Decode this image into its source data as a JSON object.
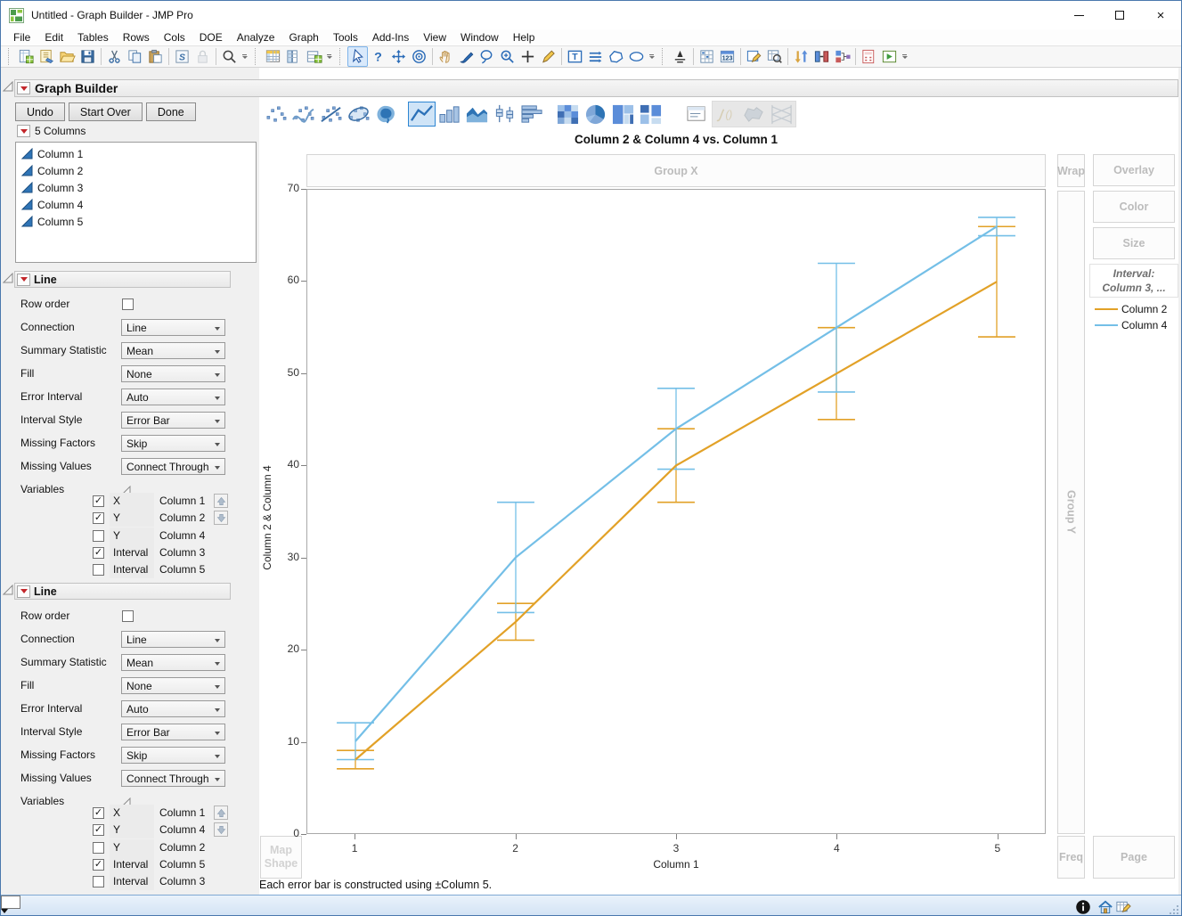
{
  "window": {
    "title": "Untitled - Graph Builder - JMP Pro"
  },
  "menu_bar": [
    "File",
    "Edit",
    "Tables",
    "Rows",
    "Cols",
    "DOE",
    "Analyze",
    "Graph",
    "Tools",
    "Add-Ins",
    "View",
    "Window",
    "Help"
  ],
  "toolbar": {
    "items": [
      {
        "t": "grip"
      },
      {
        "t": "icon",
        "n": "new-data-table"
      },
      {
        "t": "icon",
        "n": "new-journal"
      },
      {
        "t": "icon",
        "n": "open-file"
      },
      {
        "t": "icon",
        "n": "save"
      },
      {
        "t": "sep"
      },
      {
        "t": "icon",
        "n": "cut"
      },
      {
        "t": "icon",
        "n": "copy"
      },
      {
        "t": "icon",
        "n": "paste"
      },
      {
        "t": "sep"
      },
      {
        "t": "icon",
        "n": "script-center"
      },
      {
        "t": "icon",
        "n": "lock",
        "disabled": true
      },
      {
        "t": "sep"
      },
      {
        "t": "icon",
        "n": "search"
      },
      {
        "t": "chev"
      },
      {
        "t": "grip"
      },
      {
        "t": "icon",
        "n": "data-table"
      },
      {
        "t": "icon",
        "n": "new-column"
      },
      {
        "t": "icon",
        "n": "add-rows"
      },
      {
        "t": "chev"
      },
      {
        "t": "grip"
      },
      {
        "t": "icon",
        "n": "arrow-cursor",
        "selected": true
      },
      {
        "t": "icon",
        "n": "help"
      },
      {
        "t": "icon",
        "n": "move-tool"
      },
      {
        "t": "icon",
        "n": "bullseye"
      },
      {
        "t": "sep"
      },
      {
        "t": "icon",
        "n": "grabber-hand"
      },
      {
        "t": "icon",
        "n": "brush-tool"
      },
      {
        "t": "icon",
        "n": "lasso-tool"
      },
      {
        "t": "icon",
        "n": "zoom-tool"
      },
      {
        "t": "icon",
        "n": "crosshair-plus"
      },
      {
        "t": "icon",
        "n": "annotate-pencil"
      },
      {
        "t": "sep"
      },
      {
        "t": "icon",
        "n": "text-annotation"
      },
      {
        "t": "icon",
        "n": "line-annotation"
      },
      {
        "t": "icon",
        "n": "polygon-annotation"
      },
      {
        "t": "icon",
        "n": "oval-annotation"
      },
      {
        "t": "chev"
      },
      {
        "t": "grip"
      },
      {
        "t": "icon",
        "n": "pin-tool"
      },
      {
        "t": "sep"
      },
      {
        "t": "icon",
        "n": "design-grid"
      },
      {
        "t": "icon",
        "n": "date-123"
      },
      {
        "t": "sep"
      },
      {
        "t": "icon",
        "n": "edit-box"
      },
      {
        "t": "icon",
        "n": "preview-table"
      },
      {
        "t": "sep"
      },
      {
        "t": "icon",
        "n": "sort-columns"
      },
      {
        "t": "icon",
        "n": "split-columns"
      },
      {
        "t": "icon",
        "n": "join-tables"
      },
      {
        "t": "sep"
      },
      {
        "t": "icon",
        "n": "formula-calculator"
      },
      {
        "t": "icon",
        "n": "run-script"
      },
      {
        "t": "chev"
      }
    ]
  },
  "graph_builder": {
    "title": "Graph Builder",
    "buttons": [
      "Undo",
      "Start Over",
      "Done"
    ],
    "columns_panel": {
      "title": "5 Columns",
      "items": [
        "Column 1",
        "Column 2",
        "Column 3",
        "Column 4",
        "Column 5"
      ]
    }
  },
  "palette": {
    "items": [
      {
        "n": "points"
      },
      {
        "n": "smoother"
      },
      {
        "n": "fit-line"
      },
      {
        "n": "ellipse"
      },
      {
        "n": "contour"
      },
      {
        "n": "line",
        "selected": true
      },
      {
        "n": "bar"
      },
      {
        "n": "area"
      },
      {
        "n": "box-plot"
      },
      {
        "n": "histogram"
      },
      {
        "n": "heatmap"
      },
      {
        "n": "pie"
      },
      {
        "n": "treemap"
      },
      {
        "n": "mosaic"
      },
      {
        "n": "caption-box"
      },
      {
        "n": "formula",
        "disabled": true
      },
      {
        "n": "map-shapes",
        "disabled": true
      },
      {
        "n": "parallel",
        "disabled": true
      }
    ]
  },
  "line_panels": [
    {
      "title": "Line",
      "fields": [
        {
          "label": "Row order",
          "type": "checkbox",
          "checked": false
        },
        {
          "label": "Connection",
          "type": "select",
          "value": "Line"
        },
        {
          "label": "Summary Statistic",
          "type": "select",
          "value": "Mean"
        },
        {
          "label": "Fill",
          "type": "select",
          "value": "None"
        },
        {
          "label": "Error Interval",
          "type": "select",
          "value": "Auto"
        },
        {
          "label": "Interval Style",
          "type": "select",
          "value": "Error Bar"
        },
        {
          "label": "Missing Factors",
          "type": "select",
          "value": "Skip"
        },
        {
          "label": "Missing Values",
          "type": "select",
          "value": "Connect Through"
        }
      ],
      "variables_label": "Variables",
      "variables": [
        {
          "checked": true,
          "role": "X",
          "column": "Column 1",
          "arrow": "up"
        },
        {
          "checked": true,
          "role": "Y",
          "column": "Column 2",
          "arrow": "down"
        },
        {
          "checked": false,
          "role": "Y",
          "column": "Column 4"
        },
        {
          "checked": true,
          "role": "Interval",
          "column": "Column 3"
        },
        {
          "checked": false,
          "role": "Interval",
          "column": "Column 5"
        }
      ]
    },
    {
      "title": "Line",
      "fields": [
        {
          "label": "Row order",
          "type": "checkbox",
          "checked": false
        },
        {
          "label": "Connection",
          "type": "select",
          "value": "Line"
        },
        {
          "label": "Summary Statistic",
          "type": "select",
          "value": "Mean"
        },
        {
          "label": "Fill",
          "type": "select",
          "value": "None"
        },
        {
          "label": "Error Interval",
          "type": "select",
          "value": "Auto"
        },
        {
          "label": "Interval Style",
          "type": "select",
          "value": "Error Bar"
        },
        {
          "label": "Missing Factors",
          "type": "select",
          "value": "Skip"
        },
        {
          "label": "Missing Values",
          "type": "select",
          "value": "Connect Through"
        }
      ],
      "variables_label": "Variables",
      "variables": [
        {
          "checked": true,
          "role": "X",
          "column": "Column 1",
          "arrow": "up"
        },
        {
          "checked": true,
          "role": "Y",
          "column": "Column 4",
          "arrow": "down"
        },
        {
          "checked": false,
          "role": "Y",
          "column": "Column 2"
        },
        {
          "checked": true,
          "role": "Interval",
          "column": "Column 5"
        },
        {
          "checked": false,
          "role": "Interval",
          "column": "Column 3"
        }
      ]
    }
  ],
  "zones": {
    "group_x": "Group X",
    "wrap": "Wrap",
    "overlay": "Overlay",
    "color": "Color",
    "size": "Size",
    "group_y": "Group Y",
    "map_shape1": "Map",
    "map_shape2": "Shape",
    "freq": "Freq",
    "page": "Page"
  },
  "legend": {
    "interval_title": "Interval:",
    "interval_subtitle": "Column 3, ...",
    "entries": [
      {
        "label": "Column 2",
        "color": "#E2A127"
      },
      {
        "label": "Column 4",
        "color": "#74BFE7"
      }
    ]
  },
  "chart_data": {
    "type": "line",
    "title": "Column 2 & Column 4 vs. Column 1",
    "xlabel": "Column 1",
    "ylabel": "Column 2 & Column 4",
    "xlim": [
      0.7,
      5.3
    ],
    "ylim": [
      0,
      70
    ],
    "x_ticks": [
      1,
      2,
      3,
      4,
      5
    ],
    "y_ticks": [
      0,
      10,
      20,
      30,
      40,
      50,
      60,
      70
    ],
    "grid": false,
    "legend_position": "right",
    "series": [
      {
        "name": "Column 2",
        "color": "#E2A127",
        "x": [
          1,
          2,
          3,
          4,
          5
        ],
        "means": [
          8,
          23,
          40,
          50,
          60
        ],
        "interval_low": [
          7,
          21,
          36,
          45,
          54
        ],
        "interval_high": [
          9,
          25,
          44,
          55,
          66
        ],
        "interval_column": "Column 3"
      },
      {
        "name": "Column 4",
        "color": "#74BFE7",
        "x": [
          1,
          2,
          3,
          4,
          5
        ],
        "means": [
          10,
          30,
          44,
          55,
          66
        ],
        "interval_low": [
          8,
          24,
          39.6,
          48,
          65
        ],
        "interval_high": [
          12,
          36,
          48.4,
          62,
          67
        ],
        "interval_column": "Column 5"
      }
    ],
    "footnote": "Each error bar is constructed using ±Column 5."
  },
  "status_bar": {
    "icons": [
      "info",
      "home",
      "edit-table",
      "color-swatch",
      "dropdown-arrow",
      "resize-grip"
    ]
  }
}
